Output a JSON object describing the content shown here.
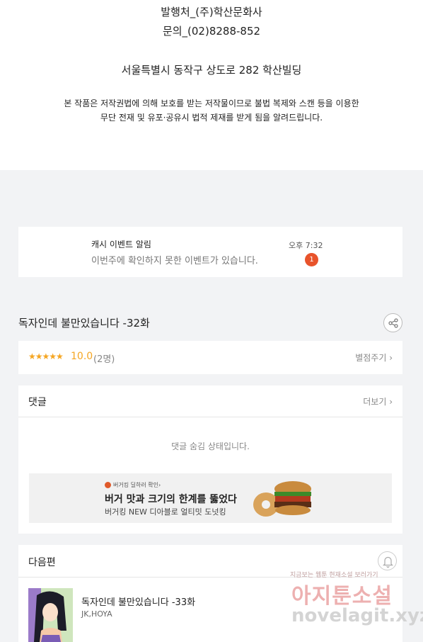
{
  "publisher": {
    "line1": "발행처_(주)학산문화사",
    "line2": "문의_(02)8288-852",
    "address": "서울특별시 동작구 상도로 282 학산빌딩",
    "notice1": "본 작품은 저작권법에 의해 보호를 받는 저작물이므로 불법 복제와 스캔 등을 이용한",
    "notice2": "무단 전재 및 유포·공유시 법적 제재를 받게 됨을 알려드립니다."
  },
  "event_notice": {
    "title": "캐시 이벤트 알림",
    "message": "이번주에 확인하지 못한 이벤트가 있습니다.",
    "time": "오후 7:32",
    "badge": "1"
  },
  "episode": {
    "title": "독자인데 불만있습니다 -32화",
    "share_icon": "share-icon"
  },
  "rating": {
    "stars": "★★★★★",
    "score": "10.0",
    "count": "(2명)",
    "rate_link": "별점주기 ›"
  },
  "comments": {
    "title": "댓글",
    "more": "더보기 ›",
    "hidden_msg": "댓글 숨김 상태입니다."
  },
  "ad": {
    "small": "버거킹 딜하러 확인›",
    "headline": "버거 맛과 크기의 한계를 뚫었다",
    "sub": "버거킹 NEW 디아블로 얼티밋 도넛킹"
  },
  "next": {
    "title": "다음편",
    "episode": "독자인데 불만있습니다 -33화",
    "author": "JK,HOYA"
  },
  "watermark": {
    "small": "지금보는 웹툰 현재소설 보러가기",
    "big": "아지툰소설",
    "url": "novelagit.xyz"
  },
  "colors": {
    "accent_star": "#f5a623",
    "badge": "#e8532b",
    "background": "#f2f3f5"
  }
}
